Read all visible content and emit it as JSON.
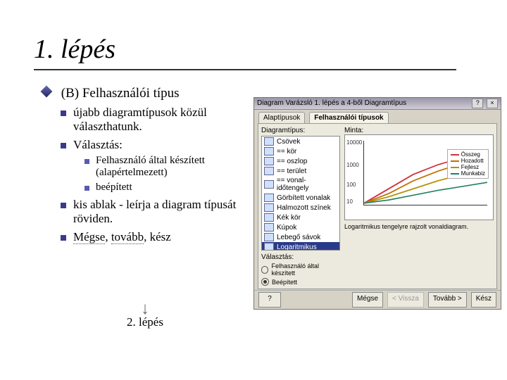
{
  "title": "1. lépés",
  "bullets": {
    "l1": "(B) Felhasználói típus",
    "l2a": "újabb diagramtípusok közül választhatunk.",
    "l2b": "Választás:",
    "l3a": "Felhasználó által készített (alapértelmezett)",
    "l3b": "beépített",
    "l2c": "kis ablak - leírja a diagram típusát röviden.",
    "l2d_part1": "Mégse",
    "l2d_part2": "tovább",
    "l2d_part3": "kész"
  },
  "flow": {
    "next": "2. lépés"
  },
  "dialog": {
    "title": "Diagram Varázsló   1. lépés a 4-ből   Diagramtípus",
    "tabs": [
      "Alaptípusok",
      "Felhasználói típusok"
    ],
    "typeLabel": "Diagramtípus:",
    "types": [
      "Csövek",
      "== kör",
      "== oszlop",
      "== terület",
      "== vonal-időtengely",
      "Görbített vonalak",
      "Halmozott színek",
      "Kék kör",
      "Kúpok",
      "Lebegő sávok",
      "Logaritmikus"
    ],
    "selectionLabel": "Választás:",
    "radios": [
      "Felhasználó által készített",
      "Beépített"
    ],
    "sampleLabel": "Minta:",
    "sample": {
      "yticks": [
        "10000",
        "1000",
        "100",
        "10"
      ],
      "series": [
        "Összeg",
        "Hozadott",
        "Fejlesz",
        "Munkabiz"
      ]
    },
    "description": "Logaritmikus tengelyre rajzolt vonaldiagram.",
    "buttons": {
      "help": "?",
      "cancel": "Mégse",
      "back": "< Vissza",
      "next": "Tovább >",
      "finish": "Kész"
    }
  },
  "chart_data": {
    "type": "line",
    "title": "Minta",
    "xlabel": "",
    "ylabel": "",
    "y_scale": "log",
    "ylim": [
      1,
      10000
    ],
    "yticks": [
      10,
      100,
      1000,
      10000
    ],
    "x": [
      1,
      2,
      3,
      4,
      5,
      6
    ],
    "series": [
      {
        "name": "Összeg",
        "values": [
          10,
          80,
          500,
          2000,
          5000,
          9000
        ]
      },
      {
        "name": "Hozadott",
        "values": [
          10,
          50,
          300,
          1200,
          3000,
          6000
        ]
      },
      {
        "name": "Fejlesz",
        "values": [
          10,
          30,
          120,
          400,
          1200,
          2500
        ]
      },
      {
        "name": "Munkabiz",
        "values": [
          10,
          20,
          50,
          120,
          250,
          500
        ]
      }
    ],
    "legend_position": "right"
  }
}
